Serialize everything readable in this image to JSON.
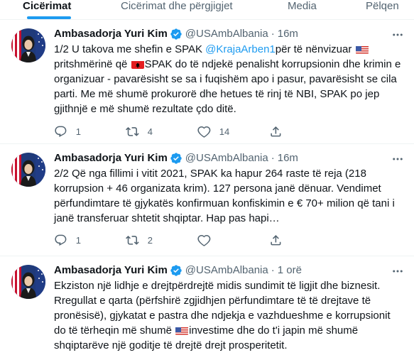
{
  "tabs": [
    {
      "label": "Cicërimat",
      "active": true
    },
    {
      "label": "Cicërimat dhe përgjigjet",
      "active": false
    },
    {
      "label": "Media",
      "active": false
    },
    {
      "label": "Pëlqen",
      "active": false
    }
  ],
  "colors": {
    "accent": "#1d9bf0",
    "muted": "#536471",
    "text": "#0f1419"
  },
  "tweets": [
    {
      "name": "Ambasadorja Yuri Kim",
      "handle": "@USAmbAlbania",
      "separator": "·",
      "time": "16m",
      "text": {
        "p1": "1/2 U takova me shefin e SPAK ",
        "mention": "@KrajaArben1",
        "p2": "për të nënvizuar ",
        "flag1": "us-flag",
        "p3": " pritshmërinë që ",
        "flag2": "albania-flag",
        "p4": "SPAK do të ndjekë penalisht korrupsionin dhe krimin e organizuar - pavarësisht se sa i fuqishëm apo i pasur, pavarësisht se cila parti. Me më shumë prokurorë dhe hetues të rinj të NBI, SPAK po jep gjithnjë e më shumë rezultate çdo ditë."
      },
      "replies": "1",
      "retweets": "4",
      "likes": "14"
    },
    {
      "name": "Ambasadorja Yuri Kim",
      "handle": "@USAmbAlbania",
      "separator": "·",
      "time": "16m",
      "text": {
        "p1": "2/2 Që nga fillimi i vitit 2021, SPAK ka hapur 264 raste të reja (218 korrupsion + 46 organizata krim). 127 persona janë dënuar. Vendimet përfundimtare të gjykatës konfirmuan konfiskimin e € 70+ milion që tani i janë transferuar shtetit shqiptar. Hap pas hapi…"
      },
      "replies": "1",
      "retweets": "2",
      "likes": ""
    },
    {
      "name": "Ambasadorja Yuri Kim",
      "handle": "@USAmbAlbania",
      "separator": "·",
      "time": "1 orë",
      "text": {
        "p1": "Ekziston një lidhje e drejtpërdrejtë midis sundimit të ligjit dhe biznesit. Rregullat e qarta (përfshirë zgjidhjen përfundimtare të të drejtave të pronësisë), gjykatat e pastra dhe ndjekja e vazhdueshme e korrupsionit do të tërheqin më shumë ",
        "flag1": "us-flag",
        "p2": "investime dhe do t'i japin më shumë shqiptarëve një goditje të drejtë drejt prosperitetit."
      }
    }
  ]
}
